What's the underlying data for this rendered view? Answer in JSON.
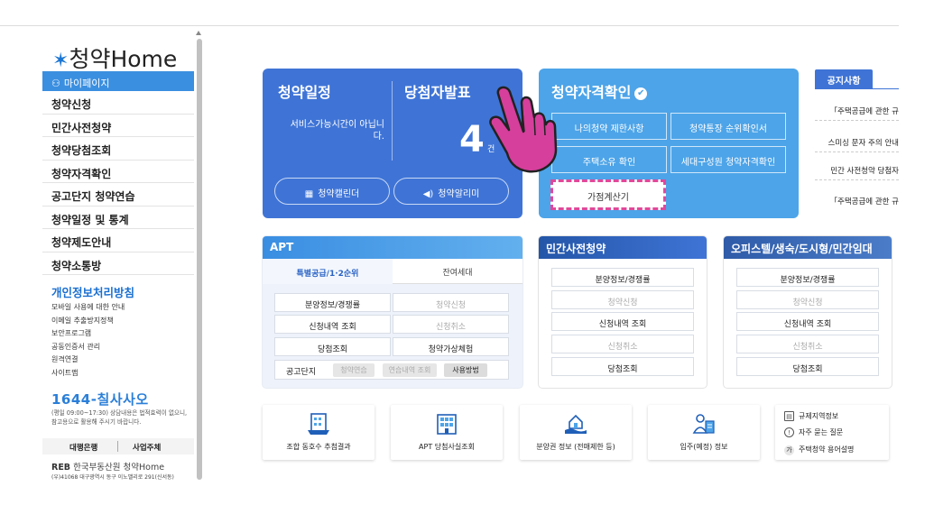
{
  "sidebar": {
    "logo_text": "청약Home",
    "mypage": "마이페이지",
    "menu": [
      "청약신청",
      "민간사전청약",
      "청약당첨조회",
      "청약자격확인",
      "공고단지 청약연습",
      "청약일정 및 통계",
      "청약제도안내",
      "청약소통방"
    ],
    "privacy_title": "개인정보처리방침",
    "sub_links": [
      "모바일 사용에 대한 안내",
      "이메일 추출방지정책",
      "보안프로그램",
      "공동인증서 관리",
      "원격연결",
      "사이트맵"
    ],
    "phone": "1644-칠사사오",
    "phone_note": "(평일 09:00~17:30) 상담내용은 법적효력이 없으니, 참고용으로 활용해 주시기 바랍니다.",
    "bank_label": "대행은행",
    "biz_label": "사업주체",
    "reb_label": "한국부동산원 청약Home",
    "reb_logo": "REB",
    "address": "(우)41068 대구광역시 동구 이노밸리로 291(신서동)"
  },
  "schedule_card": {
    "title1": "청약일정",
    "title2": "당첨자발표",
    "service_msg": "서비스가능시간이 아닙니다.",
    "count": "4",
    "count_unit": "건",
    "btn_calendar": "청약캘린더",
    "btn_alarm": "청약알리미"
  },
  "qualify_card": {
    "title": "청약자격확인",
    "buttons": [
      "나의청약 제한사항",
      "청약통장 순위확인서",
      "주택소유 확인",
      "세대구성원 청약자격확인"
    ],
    "calc_button": "가점계산기"
  },
  "notice": {
    "tab": "공지사항",
    "items": [
      "「주택공급에 관한 규",
      "스미싱 문자 주의 안내",
      "민간 사전청약 당첨자",
      "「주택공급에 관한 규"
    ]
  },
  "apt_panel": {
    "title": "APT",
    "tab_special": "특별공급/1·2순위",
    "tab_remain": "잔여세대",
    "rows": [
      [
        "분양정보/경쟁률",
        "청약신청"
      ],
      [
        "신청내역 조회",
        "신청취소"
      ],
      [
        "당첨조회",
        "청약가상체험"
      ]
    ],
    "dim_right": [
      true,
      true,
      false
    ],
    "last_label": "공고단지",
    "last_pills": [
      "청약연습",
      "연습내역 조회",
      "사용방법"
    ]
  },
  "private_panel": {
    "title": "민간사전청약",
    "items": [
      "분양정보/경쟁률",
      "청약신청",
      "신청내역 조회",
      "신청취소",
      "당첨조회"
    ],
    "dim": [
      false,
      true,
      false,
      true,
      false
    ]
  },
  "officetel_panel": {
    "title": "오피스텔/생숙/도시형/민간임대",
    "items": [
      "분양정보/경쟁률",
      "청약신청",
      "신청내역 조회",
      "신청취소",
      "당첨조회"
    ],
    "dim": [
      false,
      true,
      false,
      true,
      false
    ]
  },
  "quick_links": [
    "조합 동호수 추첨결과",
    "APT 당첨사실조회",
    "분양권 정보 (전매제한 등)",
    "입주(예정) 정보"
  ],
  "info_links": [
    "규제지역정보",
    "자주 묻는 질문",
    "주택청약 용어설명"
  ],
  "colors": {
    "primary": "#3f74d6",
    "light": "#4da4e8",
    "accent_pink": "#e0489a"
  }
}
